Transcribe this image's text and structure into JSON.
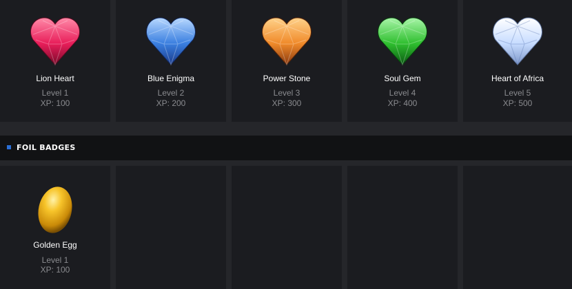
{
  "gem_badges": [
    {
      "name": "Lion Heart",
      "level": "Level 1",
      "xp": "XP: 100",
      "icon": "pink-heart-gem-icon",
      "colors": [
        "#ff4d7a",
        "#d0134a",
        "#7a0a2a"
      ]
    },
    {
      "name": "Blue Enigma",
      "level": "Level 2",
      "xp": "XP: 200",
      "icon": "blue-heart-gem-icon",
      "colors": [
        "#8fc3ff",
        "#3a7fe0",
        "#1a3a8a"
      ]
    },
    {
      "name": "Power Stone",
      "level": "Level 3",
      "xp": "XP: 300",
      "icon": "orange-heart-gem-icon",
      "colors": [
        "#ffcf7a",
        "#f08a2a",
        "#8a3a10"
      ]
    },
    {
      "name": "Soul Gem",
      "level": "Level 4",
      "xp": "XP: 400",
      "icon": "green-heart-gem-icon",
      "colors": [
        "#8cf28c",
        "#2fbf2f",
        "#0a5a12"
      ]
    },
    {
      "name": "Heart of Africa",
      "level": "Level 5",
      "xp": "XP: 500",
      "icon": "white-heart-gem-icon",
      "colors": [
        "#ffffff",
        "#c7dcff",
        "#7e98c9"
      ]
    }
  ],
  "foil_section": {
    "title": "FOIL BADGES",
    "marker_color": "#2b6fd6"
  },
  "foil_badges": [
    {
      "name": "Golden Egg",
      "level": "Level 1",
      "xp": "XP: 100",
      "icon": "golden-egg-icon",
      "colors": [
        "#ffe27a",
        "#f2b51a",
        "#8a5a05"
      ]
    }
  ]
}
